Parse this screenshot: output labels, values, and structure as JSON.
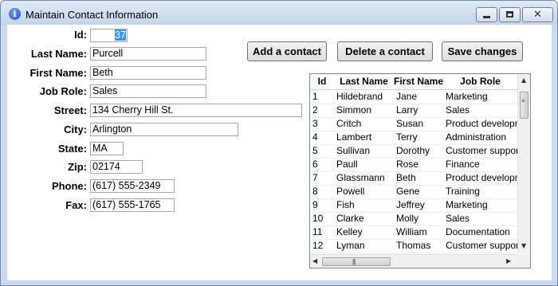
{
  "window": {
    "title": "Maintain Contact Information"
  },
  "form": {
    "id_label": "Id:",
    "id_value": "37",
    "last_name_label": "Last Name:",
    "last_name_value": "Purcell",
    "first_name_label": "First Name:",
    "first_name_value": "Beth",
    "job_role_label": "Job Role:",
    "job_role_value": "Sales",
    "street_label": "Street:",
    "street_value": "134 Cherry Hill St.",
    "city_label": "City:",
    "city_value": "Arlington",
    "state_label": "State:",
    "state_value": "MA",
    "zip_label": "Zip:",
    "zip_value": "02174",
    "phone_label": "Phone:",
    "phone_value": "(617) 555-2349",
    "fax_label": "Fax:",
    "fax_value": "(617) 555-1765"
  },
  "buttons": {
    "add": "Add a contact",
    "delete": "Delete a contact",
    "save": "Save changes"
  },
  "table": {
    "columns": [
      "Id",
      "Last Name",
      "First Name",
      "Job Role"
    ],
    "rows": [
      [
        "1",
        "Hildebrand",
        "Jane",
        "Marketing"
      ],
      [
        "2",
        "Simmon",
        "Larry",
        "Sales"
      ],
      [
        "3",
        "Critch",
        "Susan",
        "Product developme"
      ],
      [
        "4",
        "Lambert",
        "Terry",
        "Administration"
      ],
      [
        "5",
        "Sullivan",
        "Dorothy",
        "Customer support"
      ],
      [
        "6",
        "Paull",
        "Rose",
        "Finance"
      ],
      [
        "7",
        "Glassmann",
        "Beth",
        "Product developme"
      ],
      [
        "8",
        "Powell",
        "Gene",
        "Training"
      ],
      [
        "9",
        "Fish",
        "Jeffrey",
        "Marketing"
      ],
      [
        "10",
        "Clarke",
        "Molly",
        "Sales"
      ],
      [
        "11",
        "Kelley",
        "William",
        "Documentation"
      ],
      [
        "12",
        "Lyman",
        "Thomas",
        "Customer support"
      ]
    ]
  },
  "icons": {
    "title": "info-icon",
    "minimize": "minimize-icon",
    "maximize": "maximize-icon",
    "close": "close-icon"
  },
  "colors": {
    "selection": "#3399ff",
    "titlebar": "#c9daec"
  }
}
